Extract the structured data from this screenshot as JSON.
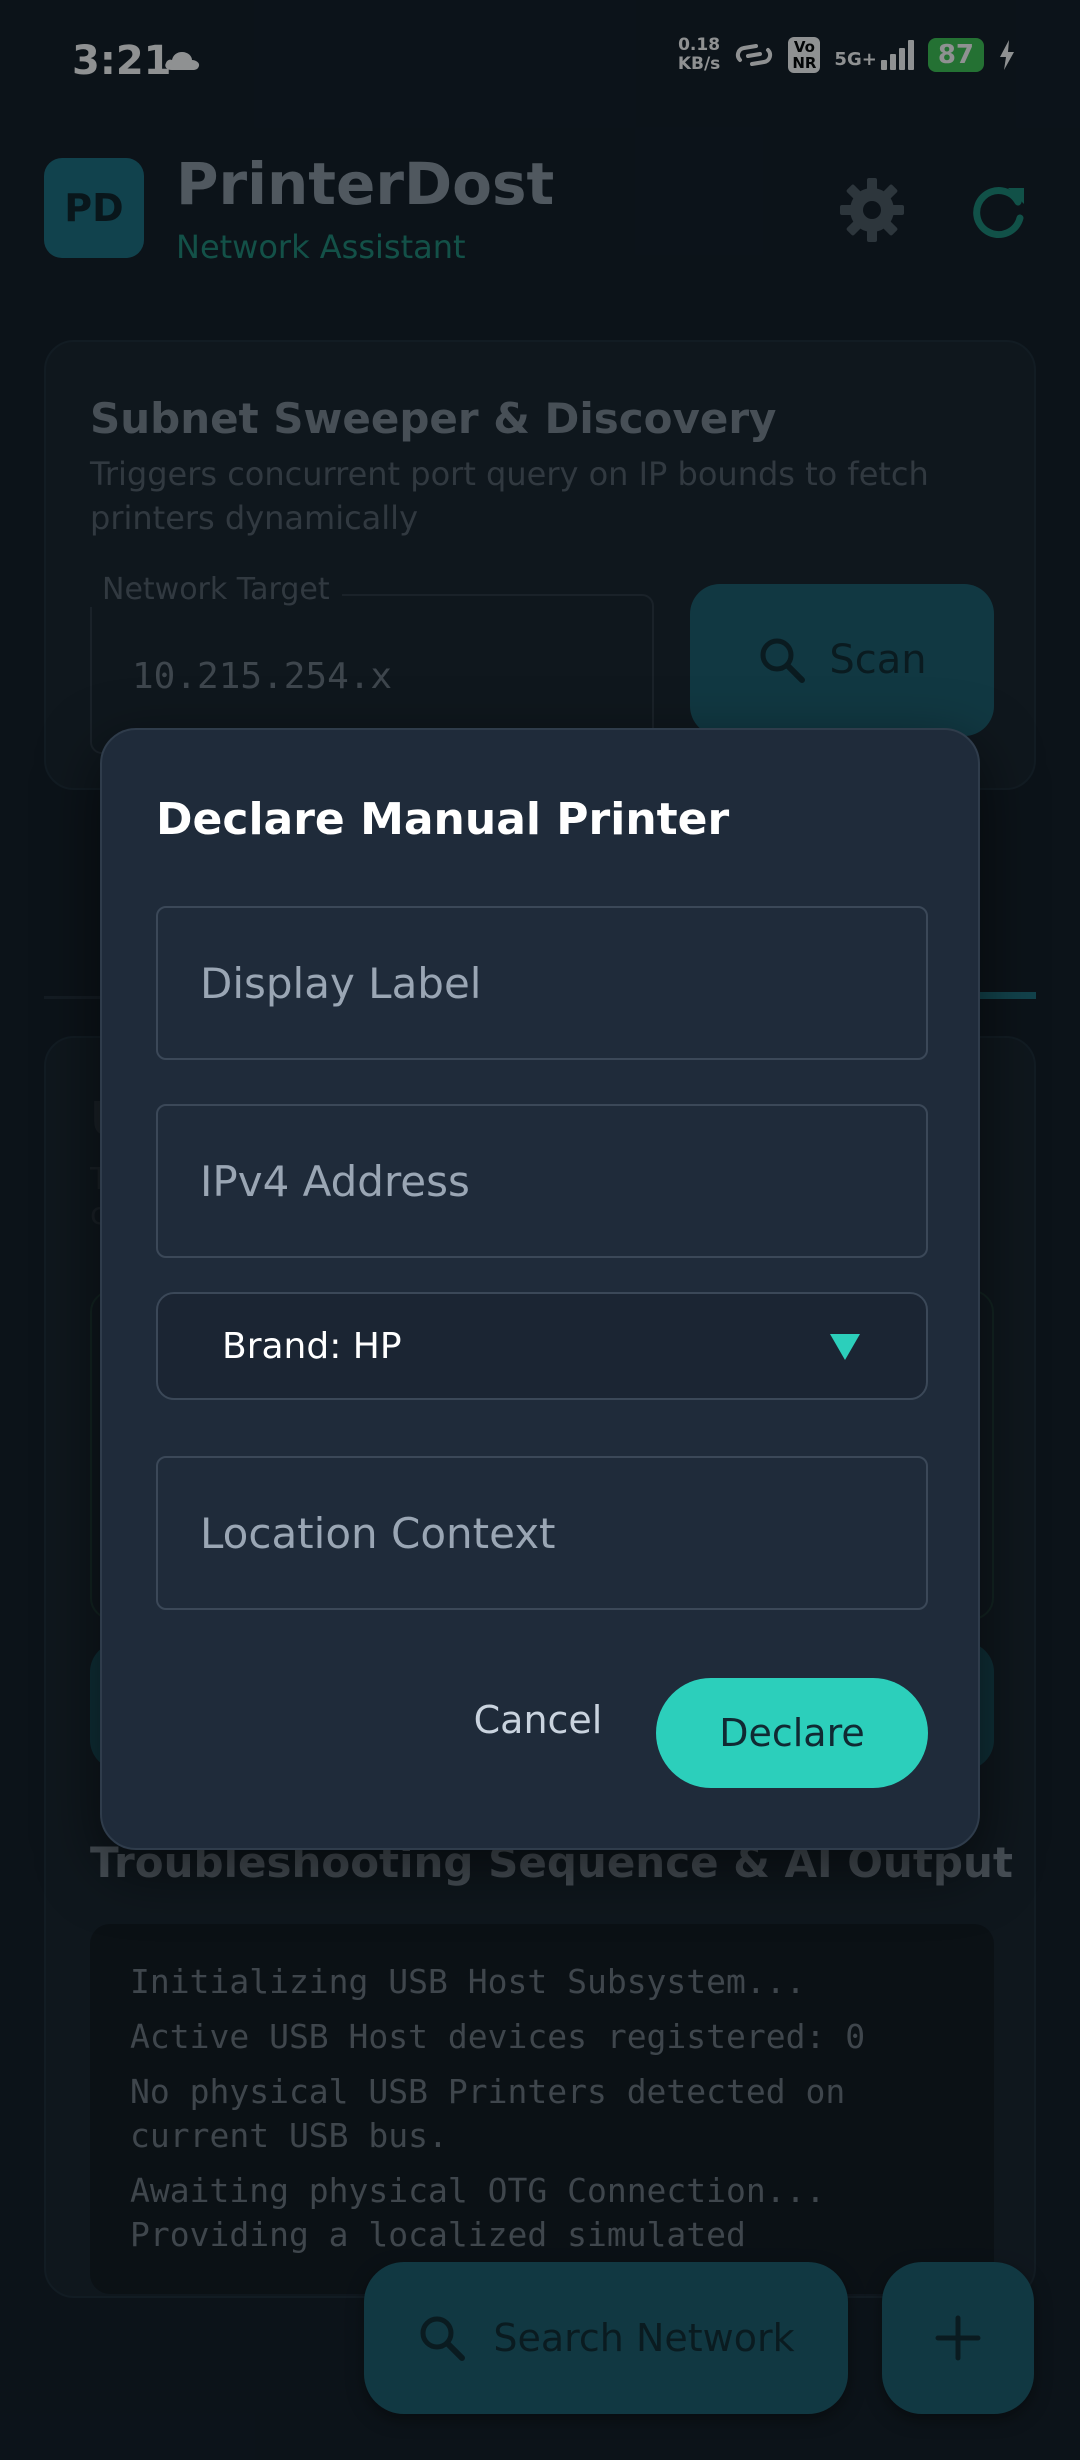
{
  "status_bar": {
    "time": "3:21",
    "speed_value": "0.18",
    "speed_unit": "KB/s",
    "volte_top": "Vo",
    "volte_bottom": "NR",
    "network": "5G+",
    "battery": "87"
  },
  "header": {
    "logo": "PD",
    "title": "PrinterDost",
    "subtitle": "Network Assistant"
  },
  "subnet_card": {
    "title": "Subnet Sweeper & Discovery",
    "description": "Triggers concurrent port query on IP bounds to fetch printers dynamically",
    "field_label": "Network Target",
    "field_value": "10.215.254.x",
    "scan_label": "Scan"
  },
  "usb_card": {
    "title_fragment": "U",
    "desc_fragment_1": "T",
    "desc_fragment_2": "c",
    "troubleshoot_title": "Troubleshooting Sequence & AI Output",
    "console_lines": [
      "Initializing USB Host Subsystem...",
      "Active USB Host devices registered: 0",
      "No physical USB Printers detected on current USB bus.",
      "Awaiting physical OTG Connection...",
      "Providing a localized simulated"
    ]
  },
  "fab": {
    "search_label": "Search Network"
  },
  "dialog": {
    "title": "Declare Manual Printer",
    "display_label_placeholder": "Display Label",
    "ipv4_placeholder": "IPv4 Address",
    "brand_select": "Brand: HP",
    "location_placeholder": "Location Context",
    "cancel_label": "Cancel",
    "declare_label": "Declare"
  },
  "colors": {
    "background": "#111a23",
    "accent": "#2ccfbb",
    "dialog_bg": "#1f2b3a",
    "teal_button": "#1b5e6d"
  }
}
